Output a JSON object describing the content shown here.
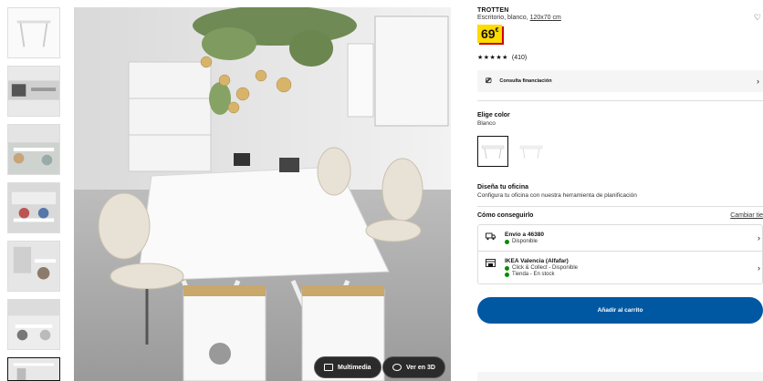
{
  "gallery": {
    "thumbnails": [
      "thumb-1",
      "thumb-2",
      "thumb-3",
      "thumb-4",
      "thumb-5",
      "thumb-6",
      "thumb-7"
    ],
    "multimedia_label": "Multimedia",
    "view3d_label": "Ver en 3D"
  },
  "product": {
    "name": "TROTTEN",
    "description": "Escritorio, blanco,",
    "size": "120x70 cm",
    "price_int": "69",
    "price_currency": "€",
    "rating_count": "(410)",
    "rating": 5
  },
  "finance": {
    "label": "Consulta financiación",
    "icon": "hand-money-icon"
  },
  "color": {
    "title": "Elige color",
    "selected": "Blanco",
    "options": [
      "white-desk",
      "white-desk-alt"
    ]
  },
  "office": {
    "title": "Diseña tu oficina",
    "text": "Configura tu oficina con nuestra herramienta de planificación"
  },
  "availability": {
    "title": "Cómo conseguirlo",
    "change_store": "Cambiar tie",
    "shipping": {
      "title": "Envío a 46380",
      "status": "Disponible",
      "icon": "truck-icon"
    },
    "store": {
      "title": "IKEA Valencia (Alfafar)",
      "line1": "Click & Collect - Disponible",
      "line2": "Tienda - En stock",
      "icon": "store-icon"
    }
  },
  "cart_label": "Añadir al carrito",
  "colors": {
    "accent": "#0058a3",
    "price_bg": "#ffdb00",
    "available": "#0a8a00"
  }
}
